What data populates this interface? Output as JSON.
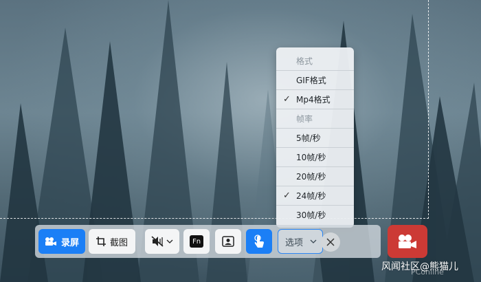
{
  "toolbar": {
    "record_label": "录屏",
    "screenshot_label": "截图",
    "fn_label": "Fn",
    "options_label": "选项"
  },
  "menu": {
    "items": [
      {
        "label": "格式",
        "type": "header"
      },
      {
        "label": "GIF格式",
        "type": "option",
        "checked": false
      },
      {
        "label": "Mp4格式",
        "type": "option",
        "checked": true
      },
      {
        "label": "帧率",
        "type": "header"
      },
      {
        "label": "5帧/秒",
        "type": "option",
        "checked": false
      },
      {
        "label": "10帧/秒",
        "type": "option",
        "checked": false
      },
      {
        "label": "20帧/秒",
        "type": "option",
        "checked": false
      },
      {
        "label": "24帧/秒",
        "type": "option",
        "checked": true
      },
      {
        "label": "30帧/秒",
        "type": "option",
        "checked": false
      }
    ],
    "check_glyph": "✓"
  },
  "watermark": {
    "text": "风闻社区@熊猫儿",
    "sub": "PConline"
  },
  "colors": {
    "accent": "#1b7ff6",
    "record": "#cc3a35"
  }
}
